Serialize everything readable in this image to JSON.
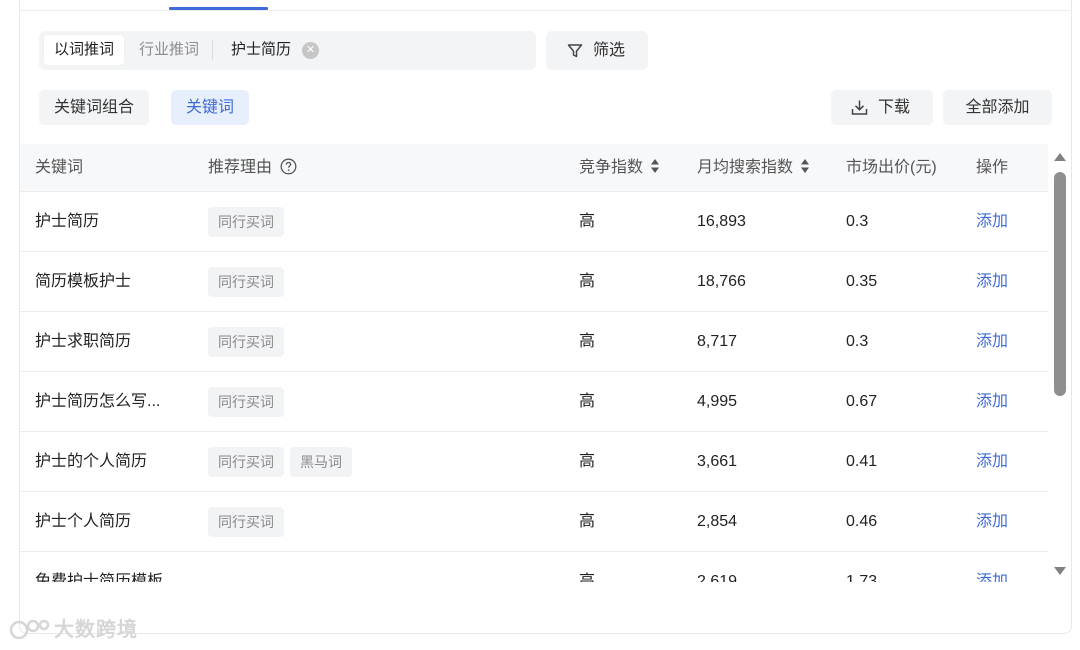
{
  "search": {
    "mode_active": "以词推词",
    "mode_inactive": "行业推词",
    "chip": "护士简历"
  },
  "filter": {
    "label": "筛选"
  },
  "toggles": {
    "combo": "关键词组合",
    "keyword": "关键词"
  },
  "actions": {
    "download": "下载",
    "add_all": "全部添加"
  },
  "table": {
    "headers": {
      "keyword": "关键词",
      "reason": "推荐理由",
      "competition": "竞争指数",
      "monthly_search": "月均搜索指数",
      "bid": "市场出价(元)",
      "action": "操作"
    },
    "rows": [
      {
        "keyword": "护士简历",
        "tags": [
          "同行买词"
        ],
        "competition": "高",
        "search": "16,893",
        "bid": "0.3",
        "action": "添加"
      },
      {
        "keyword": "简历模板护士",
        "tags": [
          "同行买词"
        ],
        "competition": "高",
        "search": "18,766",
        "bid": "0.35",
        "action": "添加"
      },
      {
        "keyword": "护士求职简历",
        "tags": [
          "同行买词"
        ],
        "competition": "高",
        "search": "8,717",
        "bid": "0.3",
        "action": "添加"
      },
      {
        "keyword": "护士简历怎么写...",
        "tags": [
          "同行买词"
        ],
        "competition": "高",
        "search": "4,995",
        "bid": "0.67",
        "action": "添加"
      },
      {
        "keyword": "护士的个人简历",
        "tags": [
          "同行买词",
          "黑马词"
        ],
        "competition": "高",
        "search": "3,661",
        "bid": "0.41",
        "action": "添加"
      },
      {
        "keyword": "护士个人简历",
        "tags": [
          "同行买词"
        ],
        "competition": "高",
        "search": "2,854",
        "bid": "0.46",
        "action": "添加"
      },
      {
        "keyword": "免费护士简历模板",
        "tags": [],
        "competition": "高",
        "search": "2,619",
        "bid": "1.73",
        "action": "添加"
      }
    ]
  },
  "watermark": {
    "text": "大数跨境"
  },
  "colors": {
    "accent": "#3f6bd8",
    "tag_bg": "#f2f3f5",
    "button_bg": "#f3f4f6"
  },
  "icons": {
    "filter": "filter-icon",
    "download": "download-icon",
    "help": "help-circle-icon",
    "sort": "sort-icon",
    "close": "close-circle-icon"
  }
}
